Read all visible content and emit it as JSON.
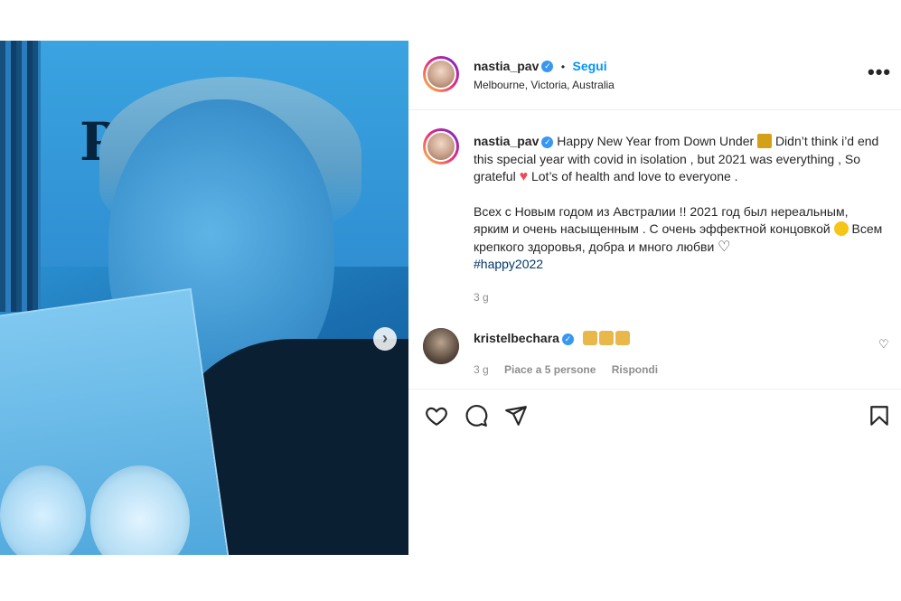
{
  "post": {
    "photo_alt": "",
    "dots": [
      true,
      false,
      false
    ]
  },
  "header": {
    "username": "nastia_pav",
    "follow_label": "Segui",
    "separator": "•",
    "location": "Melbourne, Victoria, Australia",
    "more_label": "•••"
  },
  "caption": {
    "username": "nastia_pav",
    "line1_a": "Happy New Year from Down Under",
    "line1_b": "Didn’t think i’d end this special year with covid in isolation , but 2021 was everything , So grateful",
    "line1_c": "Lot’s of health and love to everyone .",
    "ru_a": "Всех с Новым годом из Австралии !! 2021 год был нереальным, ярким и очень насыщенным . С очень эффектной концовкой",
    "ru_b": "Всем крепкого здоровья, добра и много любви",
    "hashtag": "#happy2022",
    "time": "3 g"
  },
  "comment": {
    "username": "kristelbechara",
    "time": "3 g",
    "likes": "Piace a 5 persone",
    "reply": "Rispondi"
  },
  "icons": {
    "like": "heart-icon",
    "comment": "comment-icon",
    "share": "share-icon",
    "save": "bookmark-icon",
    "next": "chevron-right-icon"
  }
}
